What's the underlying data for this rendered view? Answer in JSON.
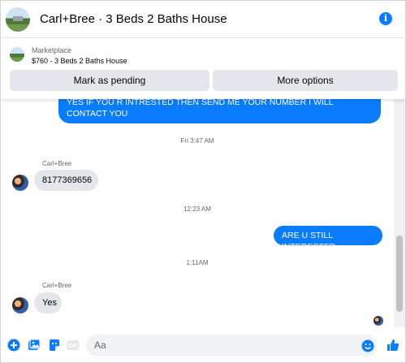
{
  "header": {
    "title": "Carl+Bree · 3 Beds 2 Baths House",
    "info_icon": "info-icon"
  },
  "marketplace_card": {
    "label": "Marketplace",
    "listing": "$760 - 3 Beds 2 Baths House",
    "mark_pending_label": "Mark as pending",
    "more_options_label": "More options"
  },
  "messages": {
    "outgoing_1": "YES IF YOU R INTRESTED THEN SEND ME YOUR NUMBER I WILL CONTACT YOU",
    "timestamp_1": "Fri 3:47 AM",
    "sender_1": "Carl+Bree",
    "incoming_1": "8177369656",
    "timestamp_2": "12:23 AM",
    "outgoing_2": "ARE U STILL INTERESTED",
    "timestamp_3": "1:11AM",
    "sender_2": "Carl+Bree",
    "incoming_2": "Yes"
  },
  "composer": {
    "placeholder": "Aa",
    "icons": [
      "plus-icon",
      "photo-icon",
      "sticker-icon",
      "gif-icon",
      "emoji-icon",
      "like-icon"
    ]
  },
  "colors": {
    "accent": "#0a7cff",
    "bubble_incoming": "#e4e6eb",
    "button_bg": "#e4e6eb",
    "muted_text": "#65676b"
  }
}
